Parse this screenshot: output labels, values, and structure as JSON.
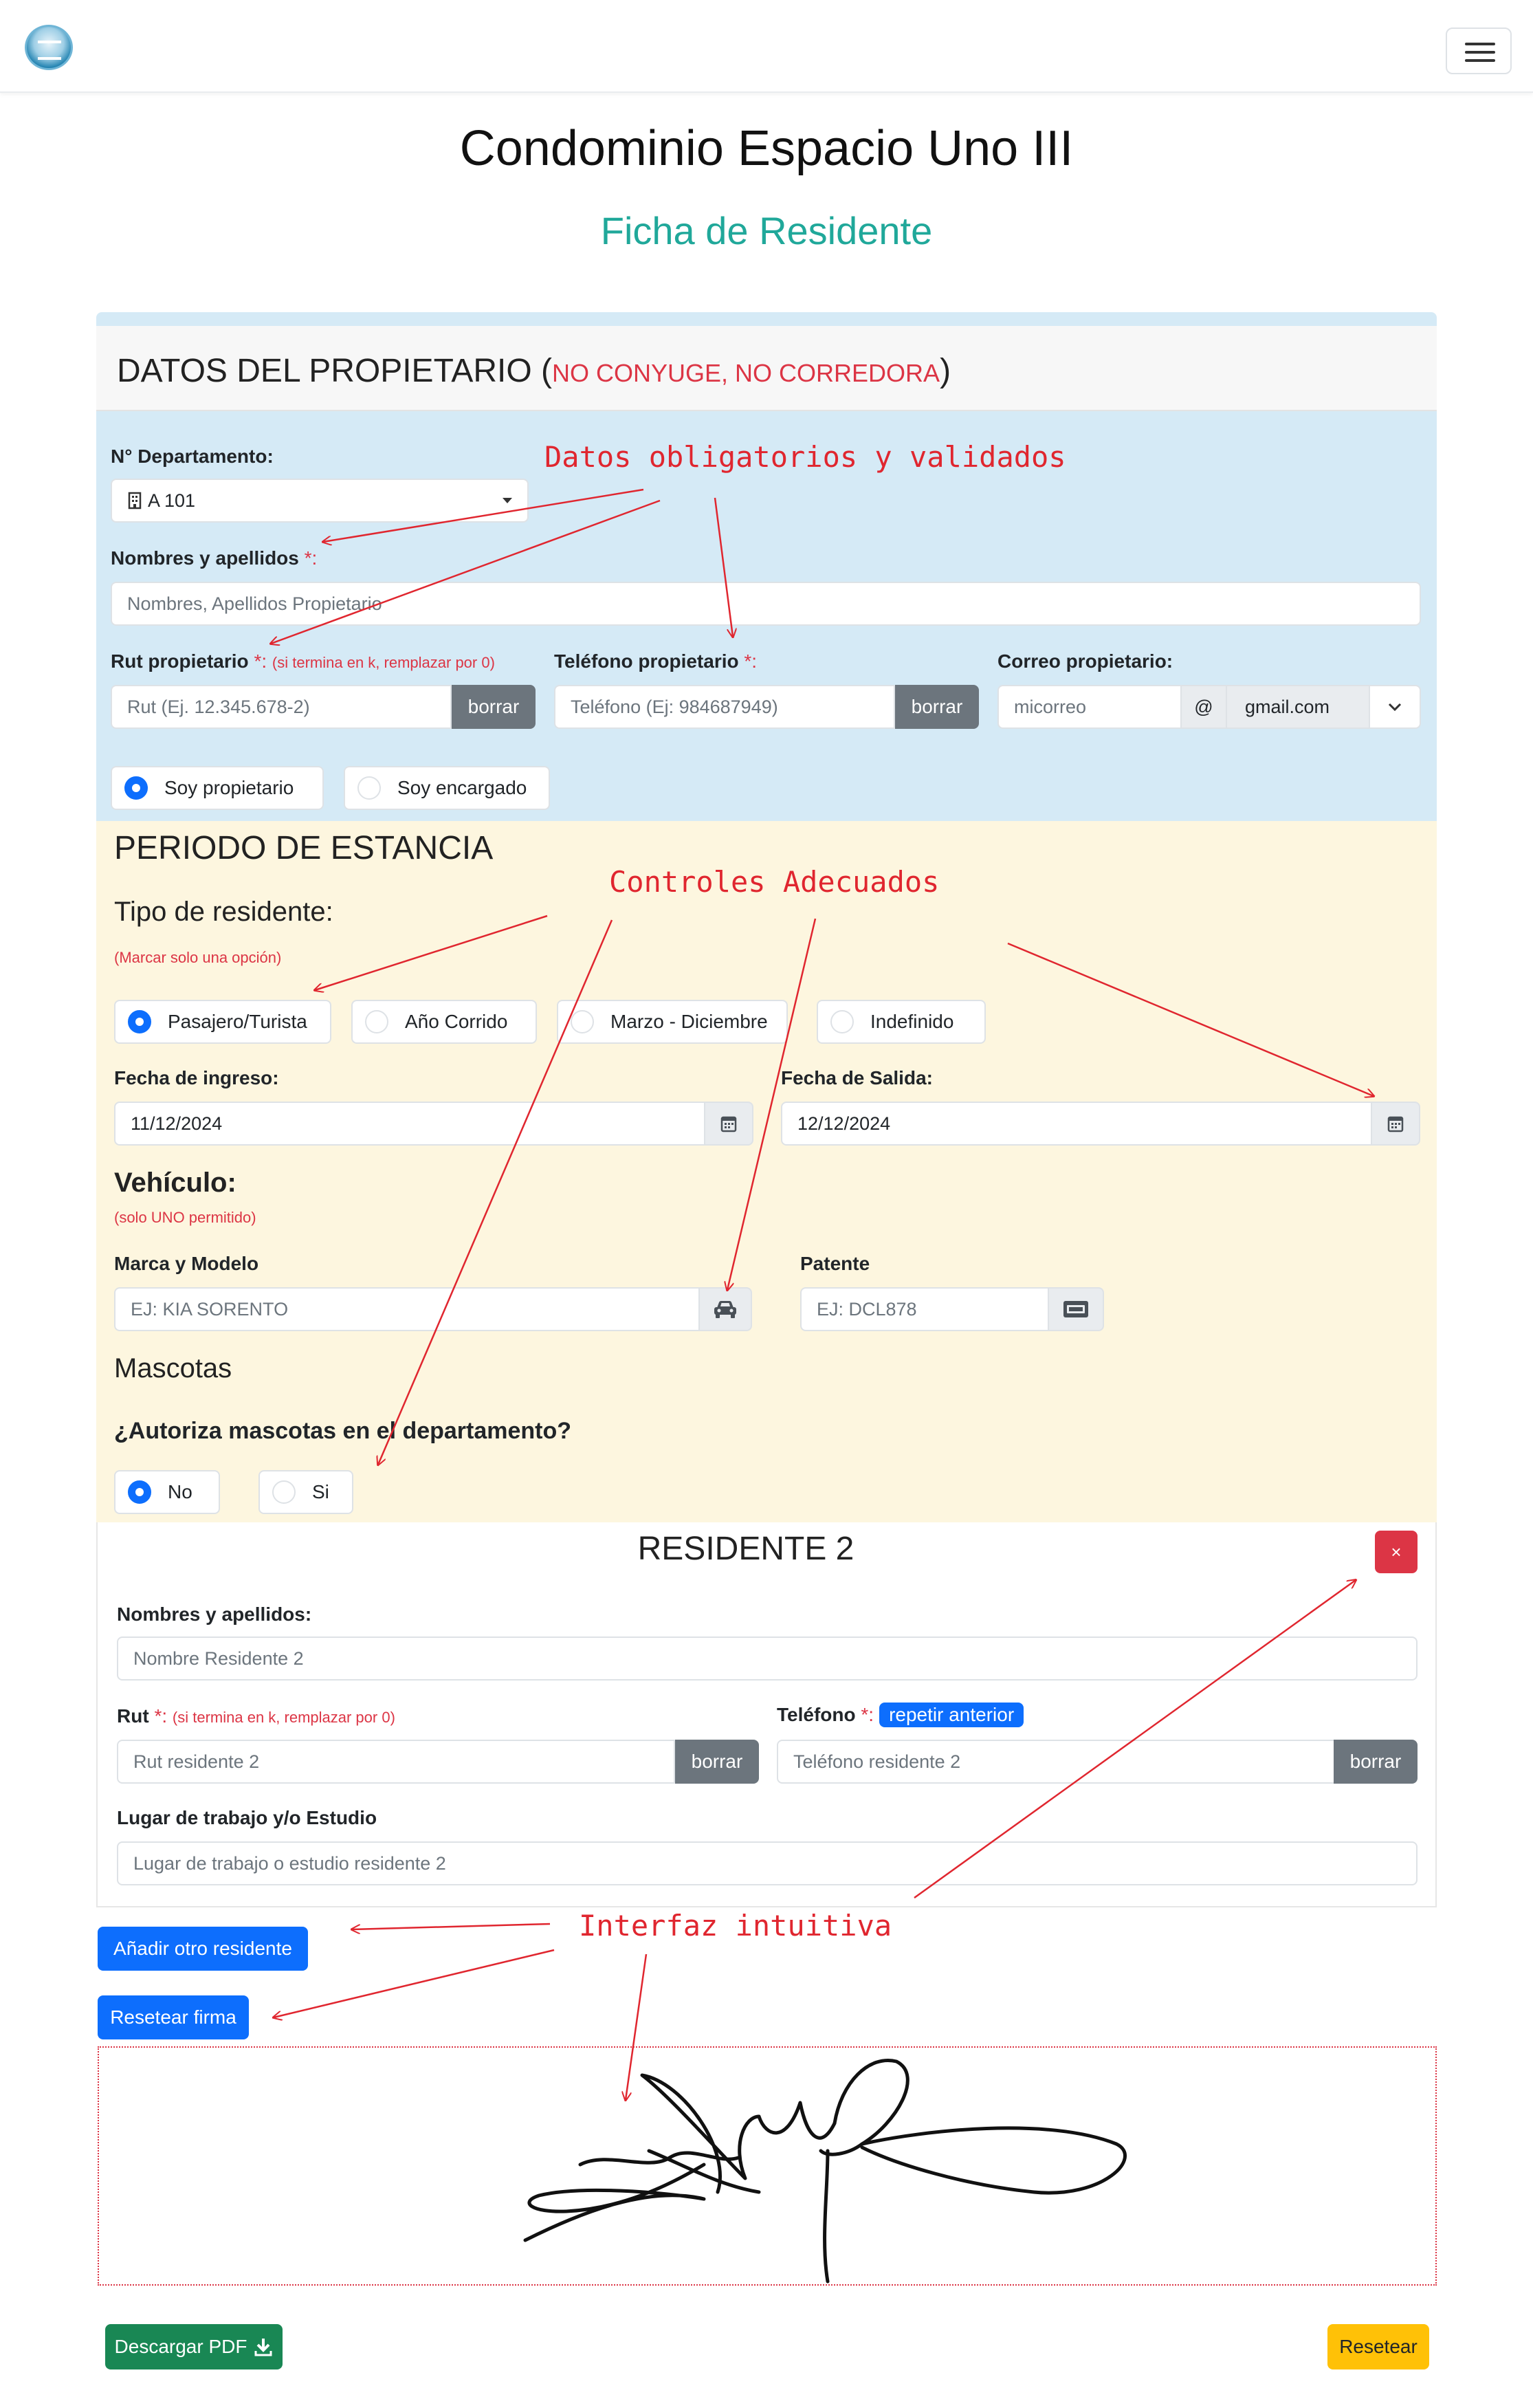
{
  "header": {
    "title": "Condominio Espacio Uno III",
    "subtitle": "Ficha de Residente"
  },
  "owner": {
    "heading": "DATOS DEL PROPIETARIO",
    "heading_note": "NO CONYUGE, NO CORREDORA",
    "dept_label": "N° Departamento:",
    "dept_value": "A 101",
    "name_label": "Nombres y apellidos",
    "name_placeholder": "Nombres, Apellidos Propietario",
    "rut_label": "Rut propietario",
    "rut_note": "(si termina en k, remplazar por 0)",
    "rut_placeholder": "Rut (Ej. 12.345.678-2)",
    "phone_label": "Teléfono propietario",
    "phone_placeholder": "Teléfono (Ej: 984687949)",
    "email_label": "Correo propietario:",
    "email_placeholder": "micorreo",
    "email_at": "@",
    "email_domain": "gmail.com",
    "clear_label": "borrar",
    "required_mark": "*:",
    "role_options": [
      {
        "label": "Soy propietario",
        "selected": true
      },
      {
        "label": "Soy encargado",
        "selected": false
      }
    ]
  },
  "stay": {
    "heading": "PERIODO DE ESTANCIA",
    "type_heading": "Tipo de residente:",
    "type_note": "(Marcar solo una opción)",
    "type_options": [
      {
        "label": "Pasajero/Turista",
        "selected": true
      },
      {
        "label": "Año Corrido",
        "selected": false
      },
      {
        "label": "Marzo - Diciembre",
        "selected": false
      },
      {
        "label": "Indefinido",
        "selected": false
      }
    ],
    "checkin_label": "Fecha de ingreso:",
    "checkin_value": "11/12/2024",
    "checkout_label": "Fecha de Salida:",
    "checkout_value": "12/12/2024",
    "vehicle_heading": "Vehículo:",
    "vehicle_note": "(solo UNO permitido)",
    "brand_label": "Marca y Modelo",
    "brand_placeholder": "EJ: KIA SORENTO",
    "plate_label": "Patente",
    "plate_placeholder": "EJ: DCL878",
    "pets_heading": "Mascotas",
    "pets_question": "¿Autoriza mascotas en el departamento?",
    "pets_options": [
      {
        "label": "No",
        "selected": true
      },
      {
        "label": "Si",
        "selected": false
      }
    ]
  },
  "resident2": {
    "title": "RESIDENTE 2",
    "remove_label": "×",
    "name_label": "Nombres y apellidos:",
    "name_placeholder": "Nombre Residente 2",
    "rut_label": "Rut",
    "rut_note": "(si termina en k, remplazar por 0)",
    "rut_placeholder": "Rut residente 2",
    "phone_label": "Teléfono",
    "repeat_label": "repetir anterior",
    "phone_placeholder": "Teléfono residente 2",
    "work_label": "Lugar de trabajo y/o Estudio",
    "work_placeholder": "Lugar de trabajo o estudio residente 2",
    "clear_label": "borrar",
    "required_mark": "*:"
  },
  "actions": {
    "add_resident": "Añadir otro residente",
    "reset_signature": "Resetear firma",
    "download_pdf": "Descargar PDF",
    "reset": "Resetear"
  },
  "annotations": {
    "required": "Datos obligatorios y validados",
    "controls": "Controles Adecuados",
    "intuitive": "Interfaz intuitiva"
  },
  "colors": {
    "subtitle": "#20a89a",
    "owner_bg": "#d5eaf6",
    "stay_bg": "#fdf6df",
    "primary": "#0d6efd",
    "danger": "#dc3545",
    "success": "#198754",
    "warning": "#ffc107",
    "annotation": "#e0262f"
  },
  "icons": {
    "dept": "building-icon",
    "dropdown": "caret-down-icon",
    "calendar": "calendar-icon",
    "car": "car-icon",
    "plate": "id-card-icon",
    "download": "download-icon",
    "menu": "hamburger-icon"
  }
}
